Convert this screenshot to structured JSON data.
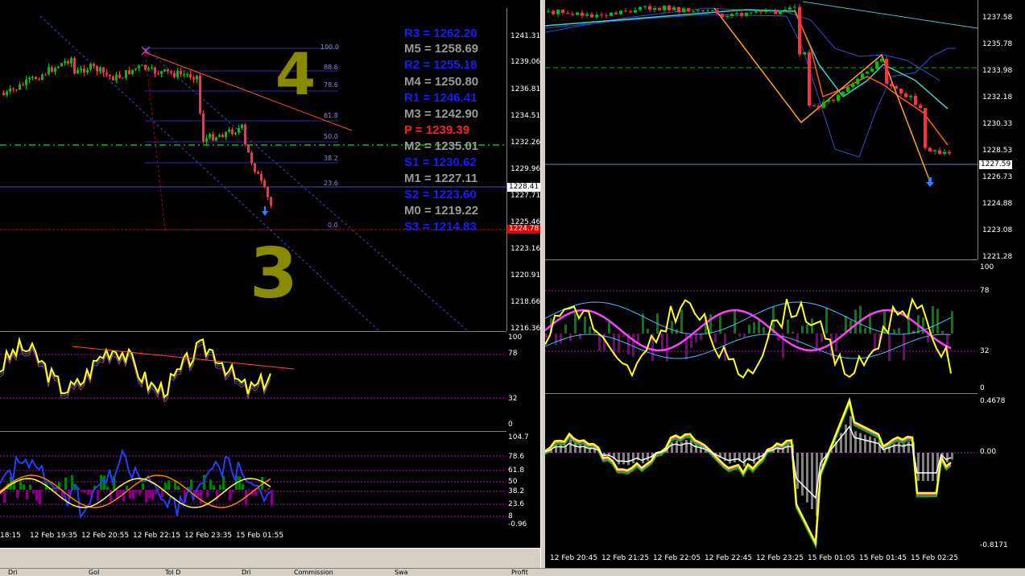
{
  "left_chart": {
    "price_labels": [
      "1241.31",
      "1239.06",
      "1236.81",
      "1234.51",
      "1232.26",
      "1229.96",
      "1227.71",
      "1225.46",
      "1223.16",
      "1220.91",
      "1218.66",
      "1216.36"
    ],
    "current_price": "1228.41",
    "red_price": "1224.78",
    "fib_levels": [
      "100.0",
      "88.6",
      "78.6",
      "61.8",
      "50.0",
      "38.2",
      "23.6",
      "0.0"
    ],
    "pivots": [
      {
        "text": "R3 = 1262.20",
        "color": "#1a1aff"
      },
      {
        "text": "M5 = 1258.69",
        "color": "#9a9a9a"
      },
      {
        "text": "R2 = 1255.18",
        "color": "#1a1aff"
      },
      {
        "text": "M4 = 1250.80",
        "color": "#9a9a9a"
      },
      {
        "text": "R1 = 1246.41",
        "color": "#1a1aff"
      },
      {
        "text": "M3 = 1242.90",
        "color": "#9a9a9a"
      },
      {
        "text": "P   = 1239.39",
        "color": "#ff2020"
      },
      {
        "text": "M2 = 1235.01",
        "color": "#9a9a9a"
      },
      {
        "text": "S1 = 1230.62",
        "color": "#1a1aff"
      },
      {
        "text": "M1 = 1227.11",
        "color": "#9a9a9a"
      },
      {
        "text": "S2 = 1223.60",
        "color": "#1a1aff"
      },
      {
        "text": "M0 = 1219.22",
        "color": "#9a9a9a"
      },
      {
        "text": "S3 = 1214.83",
        "color": "#1a1aff"
      }
    ],
    "osc1_labels": [
      "100",
      "78",
      "32",
      "0"
    ],
    "osc2_labels": [
      "104.7",
      "78.6",
      "61.8",
      "50",
      "38.2",
      "23.6",
      "8",
      "-0.96"
    ],
    "time_labels": [
      "18:15",
      "12 Feb 19:35",
      "12 Feb 20:55",
      "12 Feb 22:15",
      "12 Feb 23:35",
      "15 Feb 01:55"
    ]
  },
  "right_chart": {
    "price_labels": [
      "1237.58",
      "1235.78",
      "1233.98",
      "1232.18",
      "1230.33",
      "1228.53",
      "1226.73",
      "1224.88",
      "1223.08",
      "1221.28"
    ],
    "current_price": "1227.59",
    "osc1_labels": [
      "100",
      "78",
      "32",
      "0"
    ],
    "osc2_labels": [
      "0.4678",
      "0.00",
      "-0.8171"
    ],
    "time_labels": [
      "12 Feb 20:45",
      "12 Feb 21:25",
      "12 Feb 22:05",
      "12 Feb 22:45",
      "12 Feb 23:25",
      "15 Feb 01:05",
      "15 Feb 01:45",
      "15 Feb 02:25"
    ]
  },
  "annotations": {
    "number_4": "4",
    "number_3": "3"
  },
  "bottom_tabs": [
    "Dri",
    "Gol",
    "Tol D",
    "Dri",
    "Commission",
    "Swa",
    "Profit"
  ],
  "colors": {
    "bull": "#00c000",
    "bear": "#ff3040",
    "fib": "#2a2aa0",
    "green_dash": "#00c000",
    "red_level": "#ff0000"
  }
}
